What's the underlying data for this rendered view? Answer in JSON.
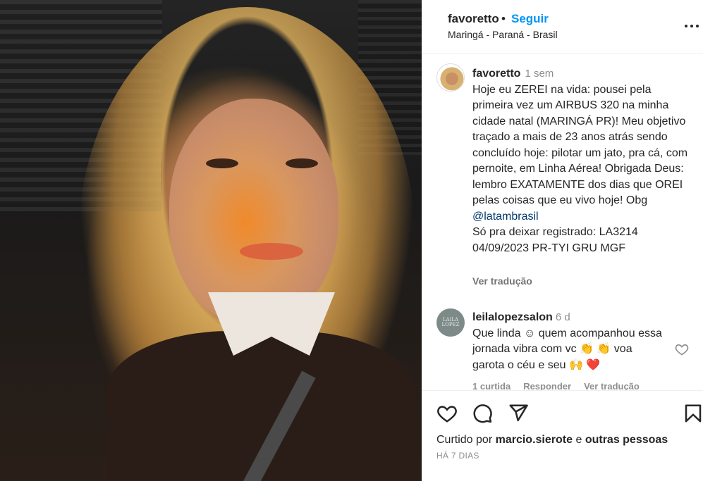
{
  "header": {
    "username": "favoretto",
    "separator": "•",
    "follow_label": "Seguir",
    "location": "Maringá - Paraná - Brasil"
  },
  "caption": {
    "username": "favoretto",
    "time": "1 sem",
    "text_main": "Hoje eu ZEREI na vida: pousei pela primeira vez um AIRBUS 320 na minha cidade natal (MARINGÁ PR)! Meu objetivo traçado a mais de 23 anos atrás sendo concluído hoje: pilotar um jato, pra cá, com pernoite, em Linha Aérea! Obrigada Deus: lembro EXATAMENTE dos dias que OREI pelas coisas que eu vivo hoje! Obg",
    "mention": "@latambrasil",
    "text_extra": "Só pra deixar registrado: LA3214 04/09/2023 PR-TYI GRU MGF",
    "translate_label": "Ver tradução"
  },
  "comment": {
    "avatar_text": "LAILA LOPEZ",
    "username": "leilalopezsalon",
    "time": "6 d",
    "text": "Que linda ☺ quem acompanhou essa jornada vibra com vc 👏 👏 voa garota o céu e seu 🙌 ❤️",
    "likes_label": "1 curtida",
    "reply_label": "Responder",
    "translate_label": "Ver tradução"
  },
  "footer": {
    "liked_prefix": "Curtido por",
    "liked_user": "marcio.sierote",
    "liked_conj": "e",
    "liked_others": "outras pessoas",
    "time_ago": "HÁ 7 DIAS"
  },
  "colors": {
    "accent": "#0095f6",
    "text": "#262626",
    "muted": "#8e8e8e",
    "mention": "#00376b"
  },
  "icons": [
    "more-icon",
    "heart-icon",
    "comment-icon",
    "share-icon",
    "bookmark-icon"
  ]
}
